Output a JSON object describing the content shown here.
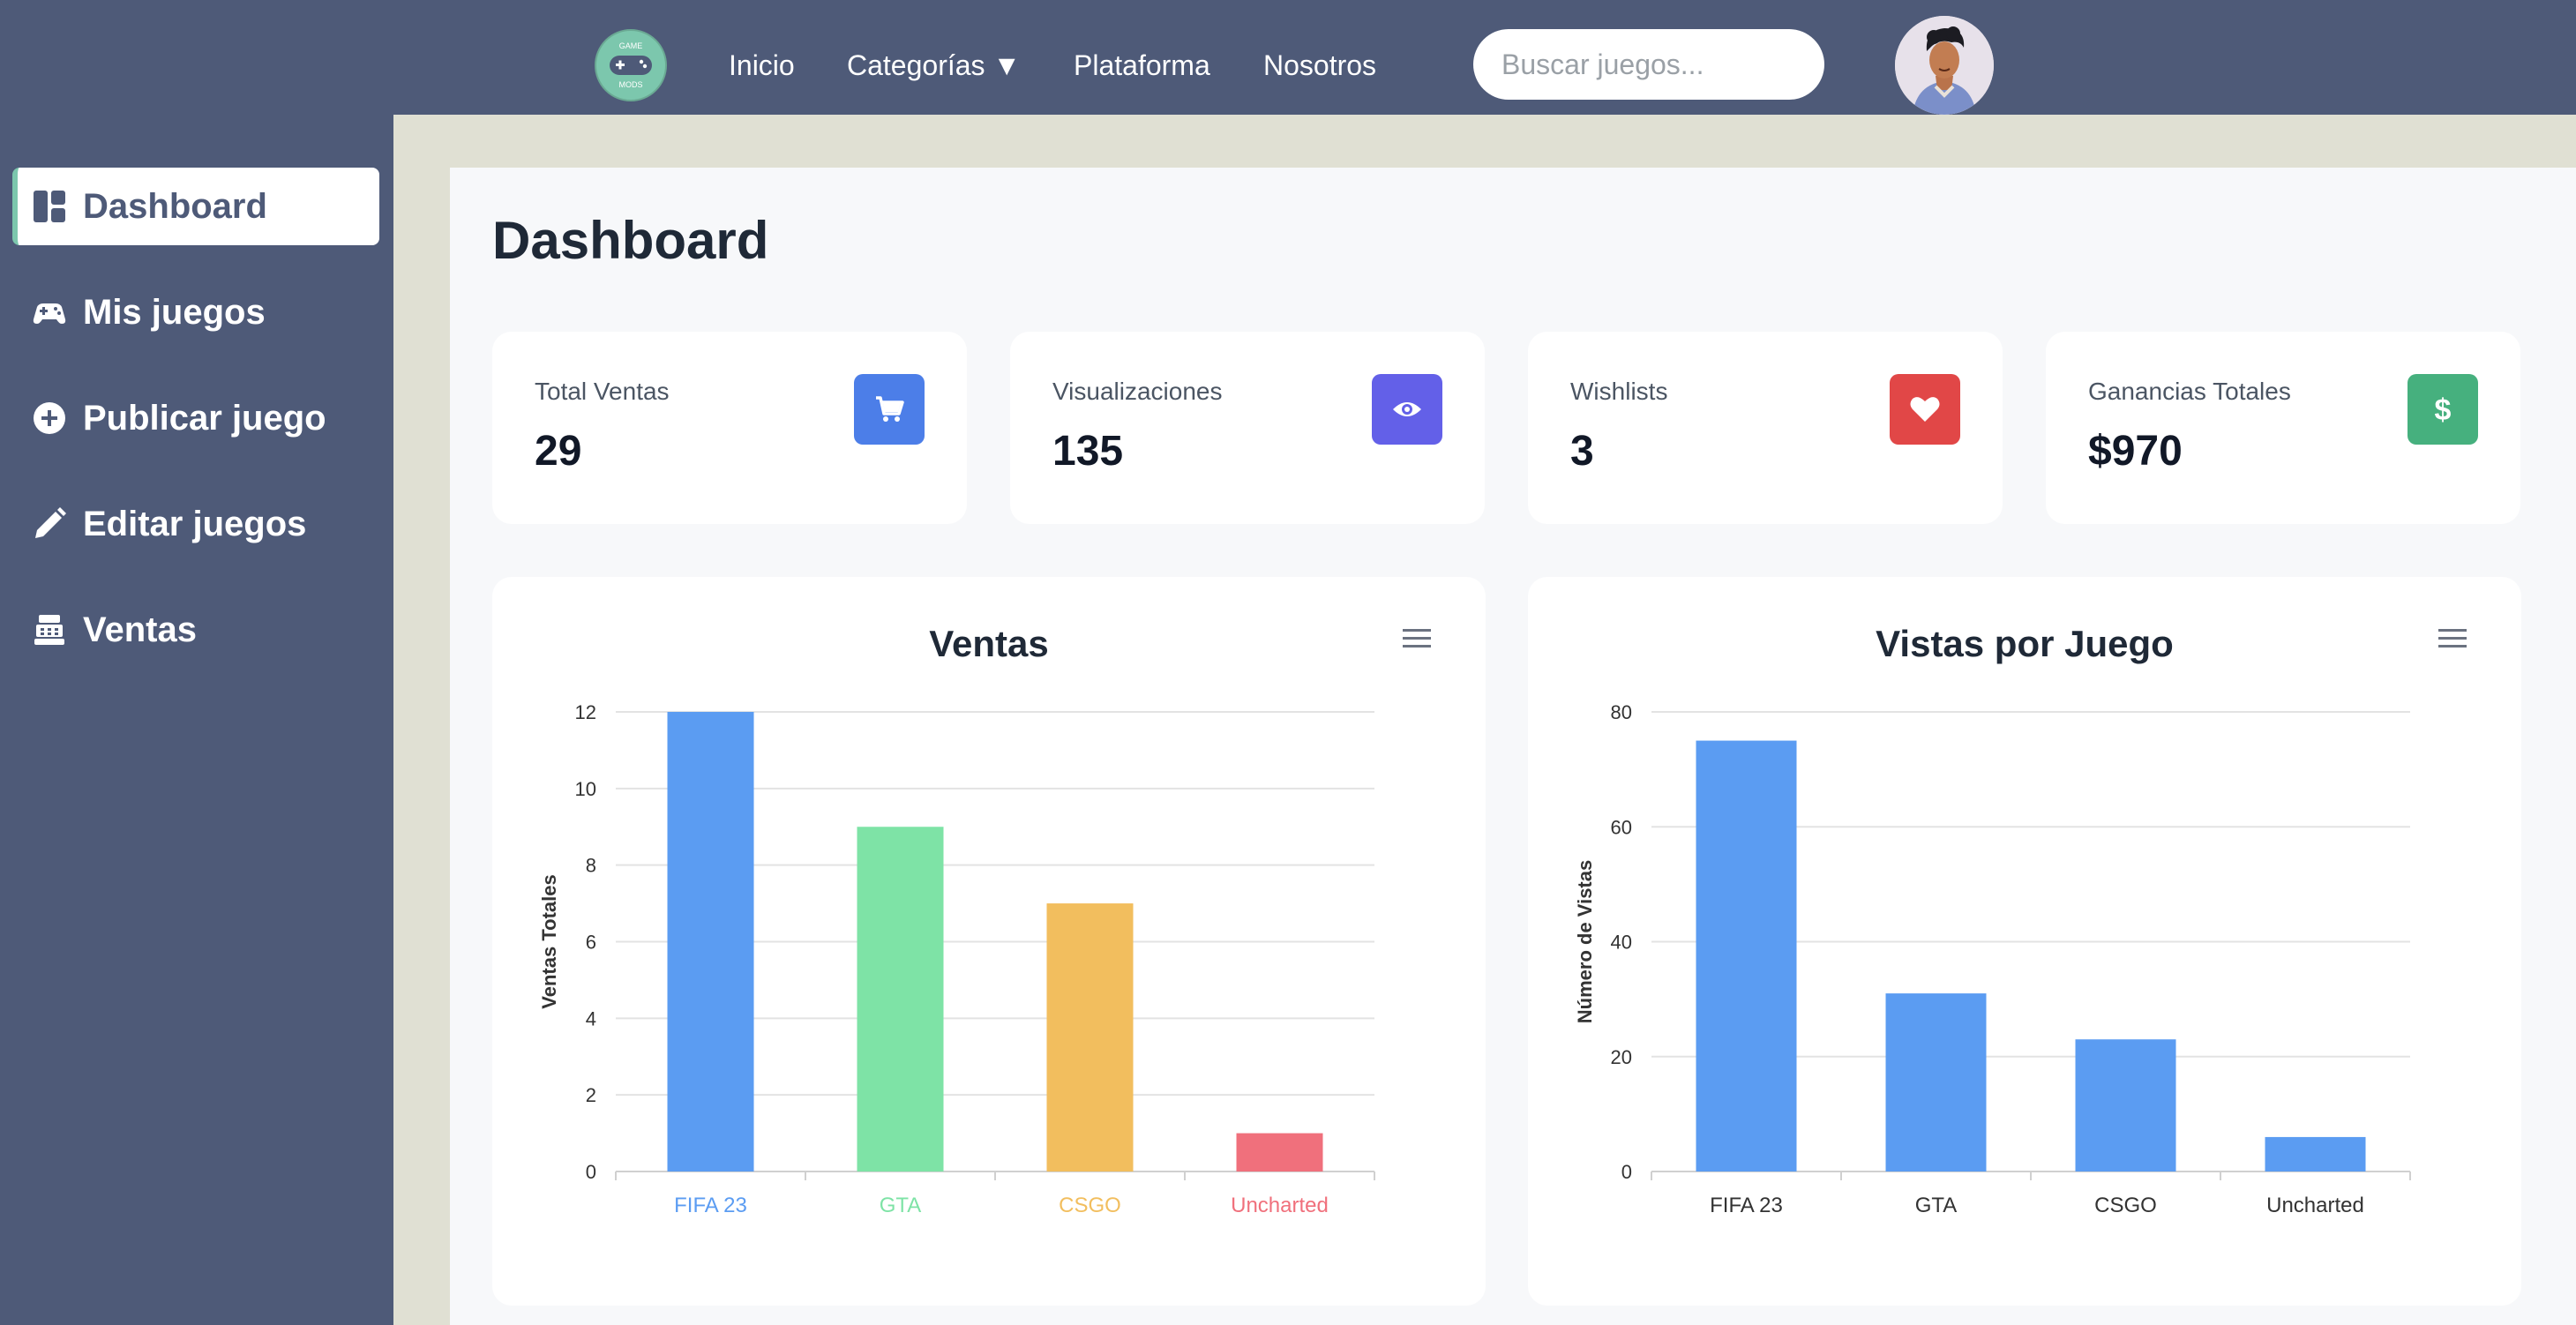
{
  "nav": {
    "links": [
      "Inicio",
      "Categorías ▼",
      "Plataforma",
      "Nosotros"
    ],
    "search_placeholder": "Buscar juegos...",
    "logo_text_top": "GAME",
    "logo_text_bottom": "MODS"
  },
  "sidebar": {
    "items": [
      {
        "label": "Dashboard",
        "icon": "dashboard-icon",
        "active": true
      },
      {
        "label": "Mis juegos",
        "icon": "gamepad-icon"
      },
      {
        "label": "Publicar juego",
        "icon": "plus-circle-icon"
      },
      {
        "label": "Editar juegos",
        "icon": "pencil-icon"
      },
      {
        "label": "Ventas",
        "icon": "cash-register-icon"
      }
    ]
  },
  "page": {
    "title": "Dashboard"
  },
  "stats": [
    {
      "label": "Total Ventas",
      "value": "29",
      "icon": "cart-icon",
      "color": "#4c7ee8"
    },
    {
      "label": "Visualizaciones",
      "value": "135",
      "icon": "eye-icon",
      "color": "#6360e8"
    },
    {
      "label": "Wishlists",
      "value": "3",
      "icon": "heart-icon",
      "color": "#e14747"
    },
    {
      "label": "Ganancias Totales",
      "value": "$970",
      "icon": "dollar-icon",
      "color": "#46b07e"
    }
  ],
  "chart_data": [
    {
      "type": "bar",
      "title": "Ventas",
      "categories": [
        "FIFA 23",
        "GTA",
        "CSGO",
        "Uncharted"
      ],
      "values": [
        12,
        9,
        7,
        1
      ],
      "colors": [
        "#5b9cf2",
        "#7ee3a6",
        "#f2be5e",
        "#f0707c"
      ],
      "ylabel": "Ventas Totales",
      "xlabel": "",
      "ylim": [
        0,
        12
      ],
      "yticks": [
        0,
        2,
        4,
        6,
        8,
        10,
        12
      ],
      "grid": true
    },
    {
      "type": "bar",
      "title": "Vistas por Juego",
      "categories": [
        "FIFA 23",
        "GTA",
        "CSGO",
        "Uncharted"
      ],
      "values": [
        75,
        31,
        23,
        6
      ],
      "colors": [
        "#5b9cf2",
        "#5b9cf2",
        "#5b9cf2",
        "#5b9cf2"
      ],
      "ylabel": "Número de Vistas",
      "xlabel": "",
      "ylim": [
        0,
        80
      ],
      "yticks": [
        0,
        20,
        40,
        60,
        80
      ],
      "grid": true
    }
  ]
}
